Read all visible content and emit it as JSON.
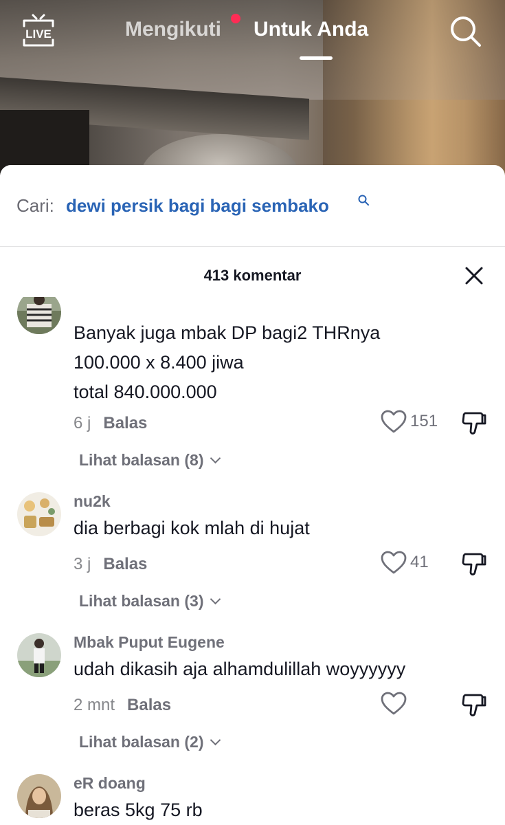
{
  "top_nav": {
    "live_label": "LIVE",
    "tabs": [
      {
        "label": "Mengikuti",
        "has_notification": true
      },
      {
        "label": "Untuk Anda",
        "active": true
      }
    ]
  },
  "search_suggestion": {
    "prefix": "Cari:",
    "term": "dewi persik bagi bagi sembako"
  },
  "comments_header": {
    "count_label": "413 komentar"
  },
  "comments": [
    {
      "username": "",
      "text_lines": [
        "Banyak juga mbak DP bagi2 THRnya",
        "100.000 x 8.400 jiwa",
        "total 840.000.000"
      ],
      "time": "6 j",
      "reply_label": "Balas",
      "likes": "151",
      "view_replies": "Lihat balasan (8)"
    },
    {
      "username": "nu2k",
      "text_lines": [
        "dia berbagi kok mlah di hujat"
      ],
      "time": "3 j",
      "reply_label": "Balas",
      "likes": "41",
      "view_replies": "Lihat balasan (3)"
    },
    {
      "username": "Mbak Puput Eugene",
      "text_lines": [
        "udah dikasih aja alhamdulillah woyyyyyy"
      ],
      "time": "2 mnt",
      "reply_label": "Balas",
      "likes": "",
      "view_replies": "Lihat balasan (2)"
    },
    {
      "username": "eR doang",
      "text_lines": [
        "beras 5kg 75 rb"
      ],
      "time": "",
      "reply_label": "",
      "likes": "",
      "view_replies": ""
    }
  ],
  "colors": {
    "accent_link": "#2a64b5",
    "notification_dot": "#fe2c55",
    "primary_text": "#161823",
    "secondary_text": "#6f7079"
  }
}
